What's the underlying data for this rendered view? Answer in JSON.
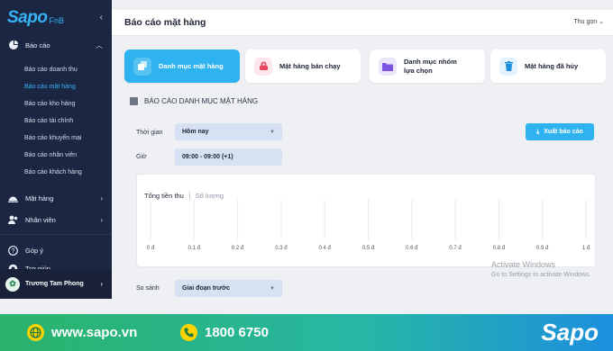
{
  "sidebar": {
    "logo": "Sapo",
    "logo_sub": "FnB",
    "collapse_icon": "chevron-left-icon",
    "report_group": "Báo cáo",
    "report_items": [
      {
        "label": "Báo cáo doanh thu"
      },
      {
        "label": "Báo cáo mặt hàng"
      },
      {
        "label": "Báo cáo kho hàng"
      },
      {
        "label": "Báo cáo tài chính"
      },
      {
        "label": "Báo cáo khuyến mại"
      },
      {
        "label": "Báo cáo nhân viên"
      },
      {
        "label": "Báo cáo khách hàng"
      }
    ],
    "products": "Mặt hàng",
    "staff": "Nhân viên",
    "feedback": "Góp ý",
    "help": "Trợ giúp",
    "user": "Trương Tam Phong"
  },
  "header": {
    "title": "Báo cáo mặt hàng",
    "collapse": "Thu gọn"
  },
  "cards": [
    {
      "label": "Danh mục mặt hàng",
      "icon": "stack-icon"
    },
    {
      "label": "Mặt hàng bán chạy",
      "icon": "fire-icon"
    },
    {
      "label": "Danh mục nhóm lựa chọn",
      "icon": "folder-icon"
    },
    {
      "label": "Mặt hàng đã hủy",
      "icon": "trash-icon"
    }
  ],
  "report": {
    "section_title": "BÁO CÁO DANH MỤC MẶT HÀNG",
    "time_label": "Thời gian",
    "time_value": "Hôm nay",
    "hour_label": "Giờ",
    "hour_value": "09:00 - 09:00 (+1)",
    "export": "Xuất báo cáo",
    "compare_label": "So sánh",
    "compare_value": "Giai đoạn trước"
  },
  "chart_data": {
    "type": "bar",
    "tabs": [
      "Tổng tiền thu",
      "Số lượng"
    ],
    "active_tab": "Tổng tiền thu",
    "x_ticks": [
      "0 đ",
      "0.1 đ",
      "0.2 đ",
      "0.3 đ",
      "0.4 đ",
      "0.5 đ",
      "0.6 đ",
      "0.7 đ",
      "0.8 đ",
      "0.9 đ",
      "1 đ"
    ],
    "xlim": [
      0,
      1
    ],
    "categories": [],
    "values": []
  },
  "watermark": {
    "line1": "Activate Windows",
    "line2": "Go to Settings to activate Windows."
  },
  "banner": {
    "website": "www.sapo.vn",
    "phone": "1800 6750",
    "brand": "Sapo"
  },
  "colors": {
    "accent": "#2fb3f0",
    "sidebar": "#1b2642",
    "active_link": "#37b3f5"
  }
}
